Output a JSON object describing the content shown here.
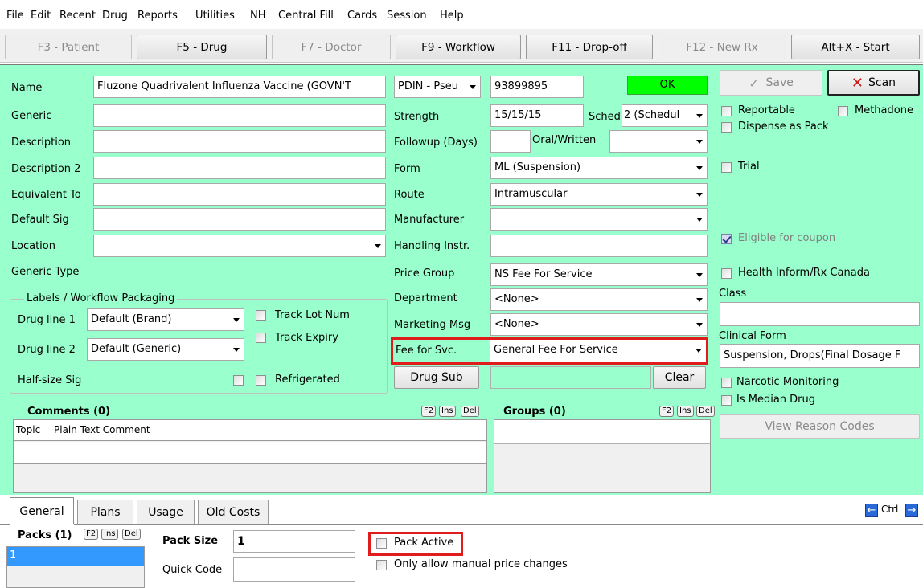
{
  "menu": [
    "File",
    "Edit",
    "Recent",
    "Drug",
    "Reports",
    "Utilities",
    "NH",
    "Central Fill",
    "Cards",
    "Session",
    "Help"
  ],
  "fkeys": [
    "F3 - Patient",
    "F5 - Drug",
    "F7 - Doctor",
    "F9 - Workflow",
    "F11 - Drop-off",
    "F12 - New Rx",
    "Alt+X - Start"
  ],
  "form": {
    "name_label": "Name",
    "name_value": "Fluzone Quadrivalent Influenza Vaccine (GOVN'T",
    "generic_label": "Generic",
    "description_label": "Description",
    "description2_label": "Description 2",
    "equivalent_label": "Equivalent To",
    "default_sig_label": "Default Sig",
    "location_label": "Location",
    "generic_type_label": "Generic Type",
    "pdin_value": "PDIN - Pseu",
    "pdin_number": "93899895",
    "ok_status": "OK",
    "save_label": "Save",
    "scan_label": "Scan",
    "strength_label": "Strength",
    "strength_value": "15/15/15",
    "sched_label": "Sched",
    "sched_value": "2 (Schedul",
    "followup_label": "Followup (Days)",
    "oral_written_label": "Oral/Written",
    "form_label": "Form",
    "form_value": "ML (Suspension)",
    "route_label": "Route",
    "route_value": "Intramuscular",
    "manufacturer_label": "Manufacturer",
    "handling_label": "Handling Instr.",
    "price_group_label": "Price Group",
    "price_group_value": "NS Fee For Service",
    "department_label": "Department",
    "department_value": "<None>",
    "marketing_label": "Marketing Msg",
    "marketing_value": "<None>",
    "fee_label": "Fee for Svc.",
    "fee_value": "General Fee For Service",
    "drug_sub_label": "Drug Sub",
    "clear_label": "Clear"
  },
  "right": {
    "reportable": "Reportable",
    "methadone": "Methadone",
    "dispense_pack": "Dispense as Pack",
    "trial": "Trial",
    "eligible_coupon": "Eligible for coupon",
    "health_inform": "Health Inform/Rx Canada",
    "class_label": "Class",
    "clinical_form_label": "Clinical Form",
    "clinical_form_value": "Suspension, Drops(Final Dosage F",
    "narcotic": "Narcotic Monitoring",
    "median": "Is Median Drug",
    "view_reason": "View Reason Codes"
  },
  "packaging": {
    "group_title": "Labels / Workflow Packaging",
    "drug_line1_label": "Drug line 1",
    "drug_line1_value": "Default (Brand)",
    "drug_line2_label": "Drug line 2",
    "drug_line2_value": "Default (Generic)",
    "half_size_label": "Half-size Sig",
    "track_lot": "Track Lot Num",
    "track_expiry": "Track Expiry",
    "refrigerated": "Refrigerated"
  },
  "comments": {
    "title": "Comments (0)",
    "col_topic": "Topic",
    "col_text": "Plain Text Comment",
    "btn_f2": "F2",
    "btn_ins": "Ins",
    "btn_del": "Del"
  },
  "groups": {
    "title": "Groups (0)"
  },
  "tabs": [
    "General",
    "Plans",
    "Usage",
    "Old Costs"
  ],
  "ctrl_label": "Ctrl",
  "bottom": {
    "packs_label": "Packs (1)",
    "pack_item": "1",
    "pack_size_label": "Pack Size",
    "pack_size_value": "1",
    "quick_code_label": "Quick Code",
    "pack_active": "Pack Active",
    "only_manual": "Only allow manual price changes"
  },
  "colors": {
    "panel": "#99ffcc",
    "ok": "#00ff00",
    "highlight": "#e01c1c",
    "selection": "#3399ff"
  }
}
